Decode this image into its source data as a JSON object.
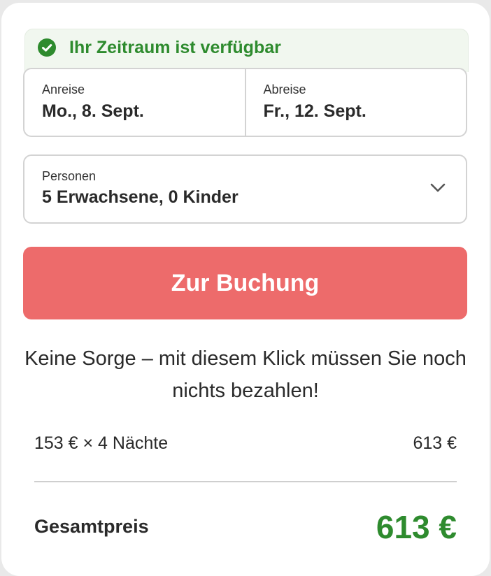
{
  "availability": {
    "message": "Ihr Zeitraum ist verfügbar",
    "icon": "check-circle-icon",
    "color": "#2e8b2e"
  },
  "dates": {
    "arrival": {
      "label": "Anreise",
      "value": "Mo., 8. Sept."
    },
    "departure": {
      "label": "Abreise",
      "value": "Fr., 12. Sept."
    }
  },
  "guests": {
    "label": "Personen",
    "value": "5 Erwachsene, 0 Kinder",
    "icon": "chevron-down-icon"
  },
  "booking": {
    "button_label": "Zur Buchung",
    "button_color": "#ed6b6b",
    "note": "Keine Sorge – mit diesem Klick müssen Sie noch nichts bezahlen!"
  },
  "price": {
    "line_label": "153 € × 4 Nächte",
    "line_value": "613 €",
    "total_label": "Gesamtpreis",
    "total_value": "613 €",
    "total_color": "#2e8b2e"
  }
}
